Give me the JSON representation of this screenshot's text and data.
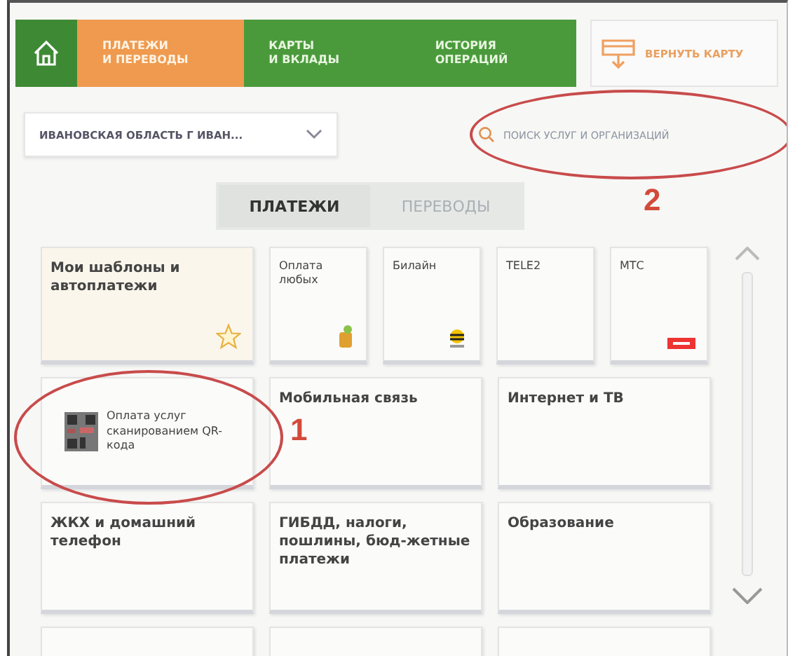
{
  "nav": {
    "items": [
      {
        "label": "ПЛАТЕЖИ\nИ ПЕРЕВОДЫ",
        "selected": true
      },
      {
        "label": "КАРТЫ\nИ ВКЛАДЫ",
        "selected": false
      },
      {
        "label": "ИСТОРИЯ\nОПЕРАЦИЙ",
        "selected": false
      }
    ],
    "return_card": "ВЕРНУТЬ КАРТУ"
  },
  "region": {
    "value": "ИВАНОВСКАЯ ОБЛАСТЬ Г ИВАН..."
  },
  "search": {
    "placeholder": "ПОИСК УСЛУГ И ОРГАНИЗАЦИЙ"
  },
  "tabs": [
    {
      "label": "ПЛАТЕЖИ",
      "selected": true
    },
    {
      "label": "ПЕРЕВОДЫ",
      "selected": false
    }
  ],
  "tile_rows": [
    [
      {
        "label": "Мои шаблоны и автоплатежи",
        "kind": "favorites"
      },
      {
        "label": "Оплата любых",
        "kind": "coin"
      },
      {
        "label": "Билайн",
        "kind": "bee"
      },
      {
        "label": "TELE2",
        "kind": "plain"
      },
      {
        "label": "МТС",
        "kind": "logo"
      }
    ],
    [
      {
        "label": "Оплата услуг сканированием QR-кода",
        "kind": "qr"
      },
      {
        "label": "Мобильная связь",
        "kind": "plain"
      },
      {
        "label": "Интернет и ТВ",
        "kind": "plain"
      }
    ],
    [
      {
        "label": "ЖКХ и домашний телефон",
        "kind": "plain"
      },
      {
        "label": "ГИБДД, налоги, пошлины, бюд-жетные платежи",
        "kind": "plain"
      },
      {
        "label": "Образование",
        "kind": "plain"
      }
    ]
  ],
  "annotations": [
    {
      "label": "1"
    },
    {
      "label": "2"
    }
  ]
}
